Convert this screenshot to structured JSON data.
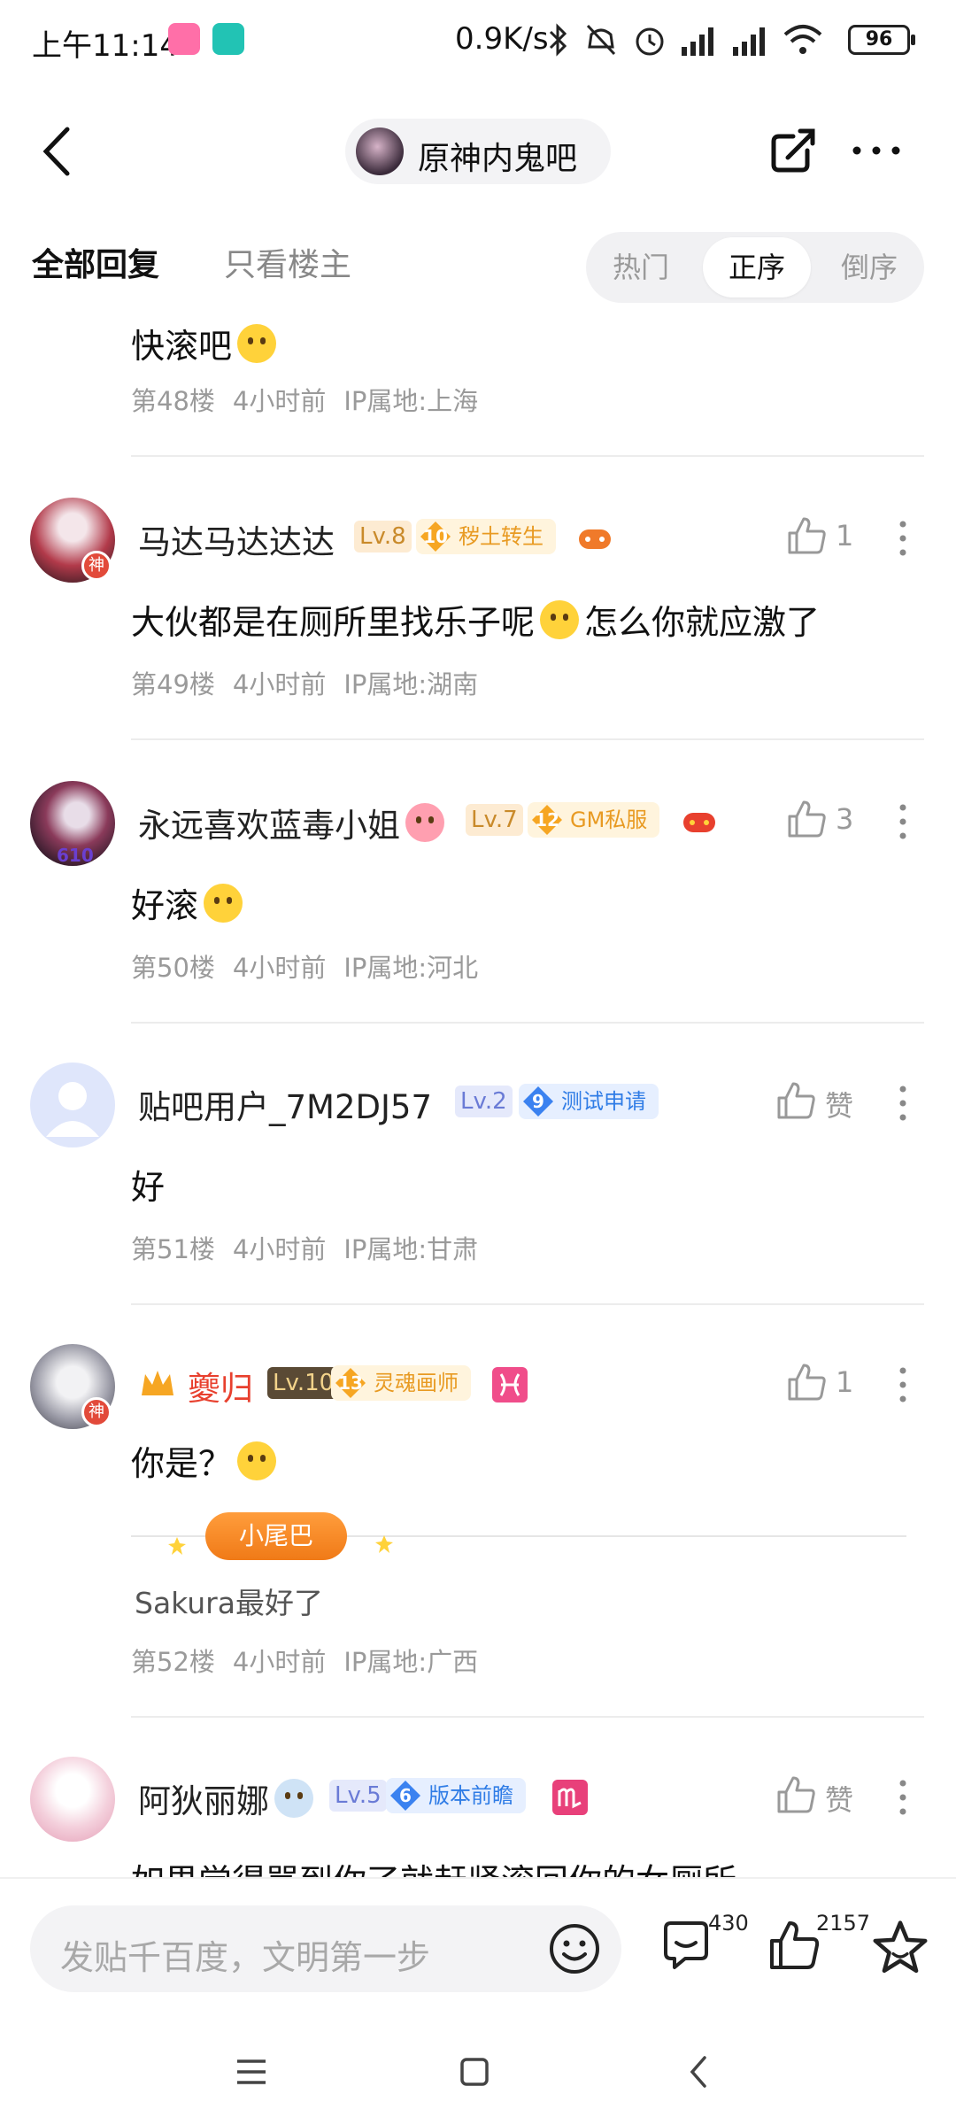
{
  "status_bar": {
    "time": "上午11:14",
    "speed": "0.9K/s",
    "battery": "96"
  },
  "header": {
    "forum_name": "原神内鬼吧"
  },
  "tabs": {
    "all_replies": "全部回复",
    "owner_only": "只看楼主",
    "sort": [
      "热门",
      "正序",
      "倒序"
    ],
    "active_sort": "正序"
  },
  "posts": [
    {
      "content": "快滚吧",
      "floor": "第48楼",
      "time": "4小时前",
      "ip": "IP属地:上海"
    },
    {
      "username": "马达马达达达",
      "level": "Lv.8",
      "badge_num": "10",
      "badge_title": "秽土转生",
      "likes": "1",
      "content": "大伙都是在厕所里找乐子呢",
      "content2": "怎么你就应激了",
      "floor": "第49楼",
      "time": "4小时前",
      "ip": "IP属地:湖南"
    },
    {
      "username": "永远喜欢蓝毒小姐",
      "level": "Lv.7",
      "badge_num": "12",
      "badge_title": "GM私服",
      "likes": "3",
      "avatar_tag": "610",
      "content": "好滚",
      "floor": "第50楼",
      "time": "4小时前",
      "ip": "IP属地:河北"
    },
    {
      "username": "贴吧用户_7M2DJ57",
      "level": "Lv.2",
      "badge_num": "9",
      "badge_title": "测试申请",
      "likes": "赞",
      "content": "好",
      "floor": "第51楼",
      "time": "4小时前",
      "ip": "IP属地:甘肃"
    },
    {
      "username": "夔归",
      "level": "Lv.10",
      "badge_num": "13",
      "badge_title": "灵魂画师",
      "likes": "1",
      "content": "你是？",
      "tail_label": "小尾巴",
      "tail_text": "Sakura最好了",
      "floor": "第52楼",
      "time": "4小时前",
      "ip": "IP属地:广西"
    },
    {
      "username": "阿狄丽娜",
      "level": "Lv.5",
      "badge_num": "6",
      "badge_title": "版本前瞻",
      "likes": "赞",
      "content": "如果觉得骂到你了就赶紧滚回你的女厕所"
    }
  ],
  "bottom_bar": {
    "placeholder": "发贴千百度，文明第一步",
    "comment_count": "430",
    "like_count": "2157"
  },
  "colors": {
    "accent_red": "#e8402e",
    "badge_gold": "#e89a22",
    "badge_blue": "#2f7ce6",
    "meta_gray": "#9a9a9a"
  }
}
